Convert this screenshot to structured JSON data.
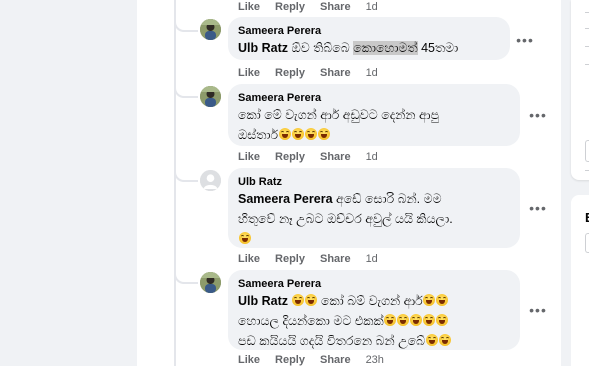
{
  "actions": {
    "like": "Like",
    "reply": "Reply",
    "share": "Share"
  },
  "icons": {
    "more": "more-options-icon",
    "emoji": "rolling-laughing-emoji-icon"
  },
  "colors": {
    "bubble": "#f0f2f5",
    "meta": "#65676b",
    "text": "#050505",
    "highlight": "#c9c9c9"
  },
  "top_actions": {
    "time": "1d"
  },
  "comments": [
    {
      "author": "Sameera Perera",
      "lines": [
        [
          "Ulb Ratz",
          " ඕව තිබ්බෙ ",
          "කොහොමත්",
          " 45තමා"
        ]
      ],
      "time": "1d"
    },
    {
      "author": "Sameera Perera",
      "line1": "කෝ මේ වැගන් ආර් අඩුවට දෙන්න ආපු",
      "line2": "ඔස්තාර්",
      "time": "1d"
    },
    {
      "author": "Ulb Ratz",
      "mention": "Sameera Perera",
      "line1": " අඩේ සොරි බන්. මම",
      "line2": "හිතුවේ නෑ උබට ඔච්චර අවුල් යයි කියලා.",
      "time": "1d"
    },
    {
      "author": "Sameera Perera",
      "mention": "Ulb Ratz",
      "line1_mid": " කෝ බම් වැගන් ආර්",
      "line2": "හොයල දියන්කො මට එකක්",
      "line3": "පඩ කයියයි ගදයි විතරනෙ බන් උබේ",
      "time": "23h"
    }
  ],
  "right_panel": {
    "glyph": "E"
  }
}
